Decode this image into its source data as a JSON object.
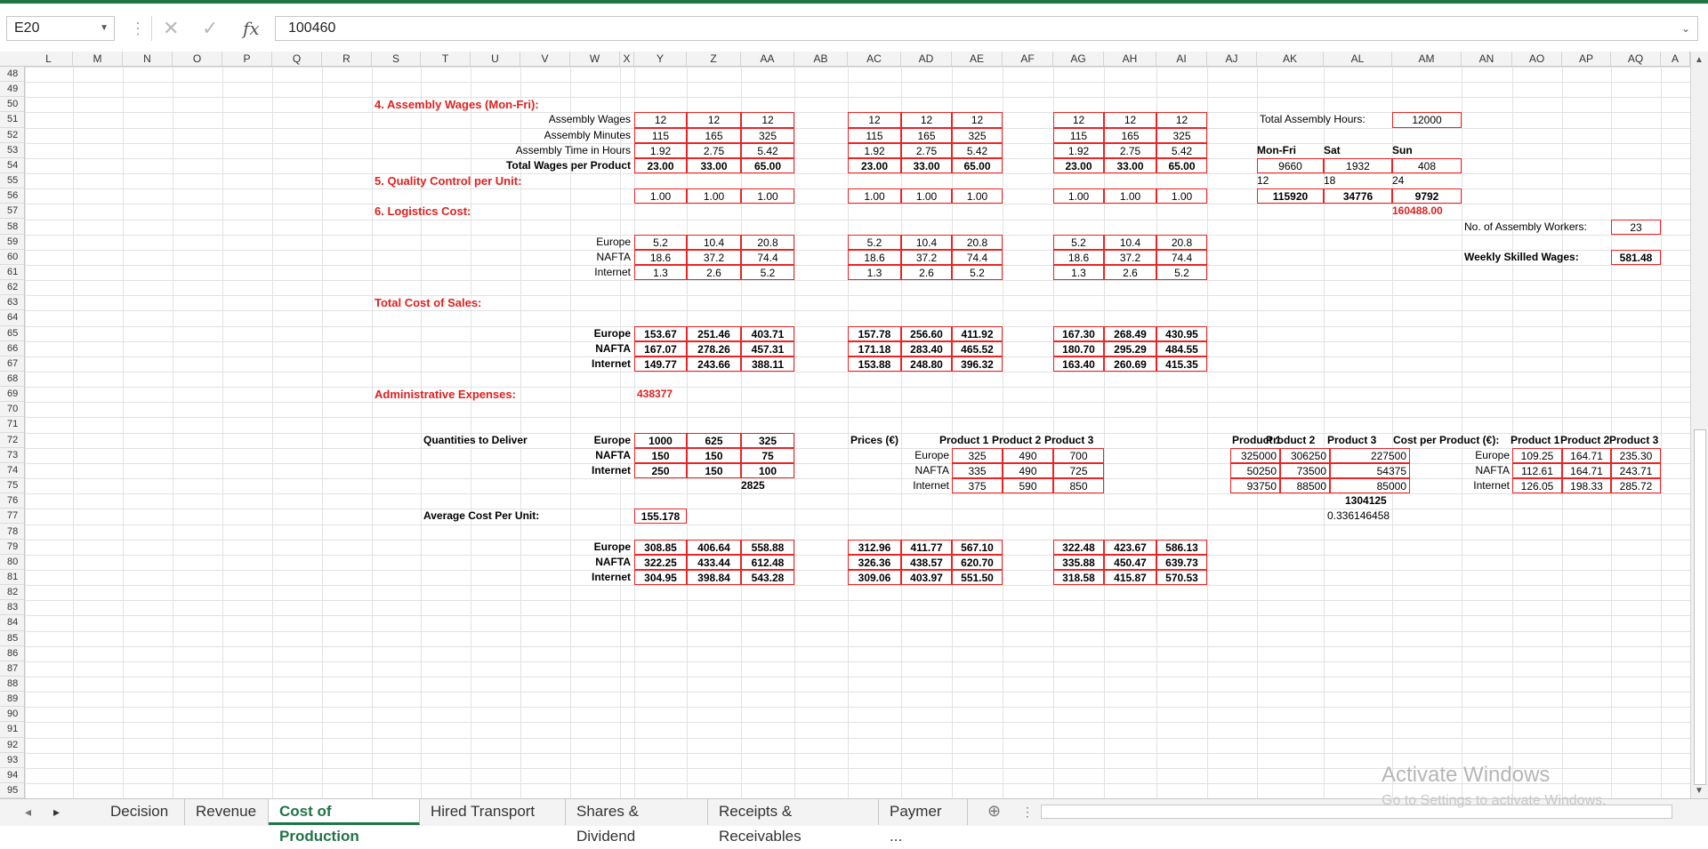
{
  "formula_bar": {
    "name_box": "E20",
    "formula": "100460"
  },
  "columns": [
    "L",
    "M",
    "N",
    "O",
    "P",
    "Q",
    "R",
    "S",
    "T",
    "U",
    "V",
    "W",
    "X",
    "Y",
    "Z",
    "AA",
    "AB",
    "AC",
    "AD",
    "AE",
    "AF",
    "AG",
    "AH",
    "AI",
    "AJ",
    "AK",
    "AL",
    "AM",
    "AN",
    "AO",
    "AP",
    "AQ",
    "A"
  ],
  "rows_start": 48,
  "rows_end": 95,
  "sections": {
    "assembly_wages": "4. Assembly Wages (Mon-Fri):",
    "quality_control": "5. Quality Control per Unit:",
    "logistics": "6. Logistics Cost:",
    "total_cost": "Total Cost of Sales:",
    "admin": "Administrative Expenses:",
    "admin_value": "438377"
  },
  "labels": {
    "assembly_wages": "Assembly Wages",
    "assembly_minutes": "Assembly Minutes",
    "assembly_hours": "Assembly Time in Hours",
    "total_wages": "Total Wages per Product",
    "europe": "Europe",
    "nafta": "NAFTA",
    "internet": "Internet",
    "quantities": "Quantities to Deliver",
    "avg_cost": "Average Cost Per Unit:",
    "avg_cost_value": "155.178",
    "prices": "Prices (€)",
    "cost_per_product": "Cost per Product (€):",
    "product1": "Product 1",
    "product2": "Product 2",
    "product3": "Product 3",
    "total_assembly_hours": "Total Assembly Hours:",
    "total_assembly_hours_value": "12000",
    "no_workers": "No. of Assembly Workers:",
    "no_workers_value": "23",
    "weekly_wages": "Weekly Skilled Wages:",
    "weekly_wages_value": "581.48",
    "mon_fri": "Mon-Fri",
    "sat": "Sat",
    "sun": "Sun"
  },
  "wages_block": [
    [
      "12",
      "12",
      "12"
    ],
    [
      "115",
      "165",
      "325"
    ],
    [
      "1.92",
      "2.75",
      "5.42"
    ],
    [
      "23.00",
      "33.00",
      "65.00"
    ]
  ],
  "qc_block": [
    "1.00",
    "1.00",
    "1.00"
  ],
  "logistics_block": [
    [
      "5.2",
      "10.4",
      "20.8"
    ],
    [
      "18.6",
      "37.2",
      "74.4"
    ],
    [
      "1.3",
      "2.6",
      "5.2"
    ]
  ],
  "total_cost_blocks": [
    [
      [
        "153.67",
        "251.46",
        "403.71"
      ],
      [
        "167.07",
        "278.26",
        "457.31"
      ],
      [
        "149.77",
        "243.66",
        "388.11"
      ]
    ],
    [
      [
        "157.78",
        "256.60",
        "411.92"
      ],
      [
        "171.18",
        "283.40",
        "465.52"
      ],
      [
        "153.88",
        "248.80",
        "396.32"
      ]
    ],
    [
      [
        "167.30",
        "268.49",
        "430.95"
      ],
      [
        "180.70",
        "295.29",
        "484.55"
      ],
      [
        "163.40",
        "260.69",
        "415.35"
      ]
    ]
  ],
  "hours_block": [
    [
      "9660",
      "1932",
      "408"
    ],
    [
      "12",
      "18",
      "24"
    ],
    [
      "115920",
      "34776",
      "9792"
    ]
  ],
  "hours_total": "160488.00",
  "quantities_block": [
    [
      "1000",
      "625",
      "325"
    ],
    [
      "150",
      "150",
      "75"
    ],
    [
      "250",
      "150",
      "100"
    ]
  ],
  "quantities_total": "2825",
  "prices_block": [
    [
      "325",
      "490",
      "700"
    ],
    [
      "335",
      "490",
      "725"
    ],
    [
      "375",
      "590",
      "850"
    ]
  ],
  "revenue_block": [
    [
      "325000",
      "306250",
      "227500"
    ],
    [
      "50250",
      "73500",
      "54375"
    ],
    [
      "93750",
      "88500",
      "85000"
    ]
  ],
  "revenue_total": "1304125",
  "revenue_ratio": "0.336146458",
  "cost_per_product_block": [
    [
      "109.25",
      "164.71",
      "235.30"
    ],
    [
      "112.61",
      "164.71",
      "243.71"
    ],
    [
      "126.05",
      "198.33",
      "285.72"
    ]
  ],
  "bottom_blocks": [
    [
      [
        "308.85",
        "406.64",
        "558.88"
      ],
      [
        "322.25",
        "433.44",
        "612.48"
      ],
      [
        "304.95",
        "398.84",
        "543.28"
      ]
    ],
    [
      [
        "312.96",
        "411.77",
        "567.10"
      ],
      [
        "326.36",
        "438.57",
        "620.70"
      ],
      [
        "309.06",
        "403.97",
        "551.50"
      ]
    ],
    [
      [
        "322.48",
        "423.67",
        "586.13"
      ],
      [
        "335.88",
        "450.47",
        "639.73"
      ],
      [
        "318.58",
        "415.87",
        "570.53"
      ]
    ]
  ],
  "tabs": [
    {
      "label": "Decision",
      "active": false
    },
    {
      "label": "Revenue",
      "active": false
    },
    {
      "label": "Cost of Production",
      "active": true
    },
    {
      "label": "Hired Transport",
      "active": false
    },
    {
      "label": "Shares & Dividend",
      "active": false
    },
    {
      "label": "Receipts & Receivables",
      "active": false
    },
    {
      "label": "Paymer ...",
      "active": false
    }
  ],
  "watermark": {
    "line1": "Activate Windows",
    "line2": "Go to Settings to activate Windows."
  }
}
